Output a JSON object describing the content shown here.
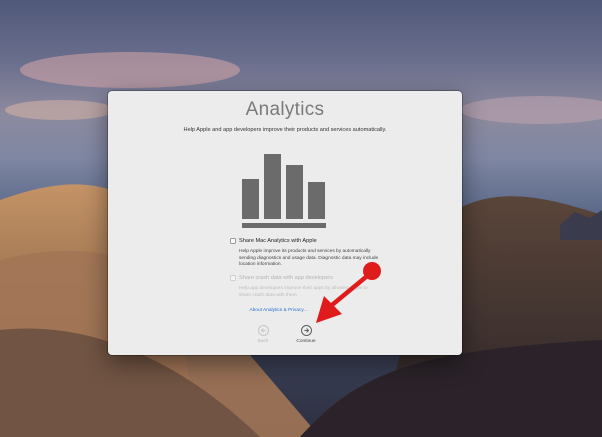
{
  "dialog": {
    "title": "Analytics",
    "subtitle": "Help Apple and app developers improve their products and services automatically.",
    "share_mac": {
      "label": "Share Mac Analytics with Apple",
      "checked": false,
      "description": "Help Apple improve its products and services by automatically sending diagnostics and usage data. Diagnostic data may include location information."
    },
    "share_crash": {
      "label": "Share crash data with app developers",
      "checked": false,
      "enabled": false,
      "description": "Help app developers improve their apps by allowing Apple to share crash data with them."
    },
    "about_link": "About Analytics & Privacy…",
    "back_label": "Back",
    "continue_label": "Continue"
  },
  "colors": {
    "dialog_bg": "#ececec",
    "chart_bars": "#6b6b6b",
    "link": "#2a6fd1",
    "annotation_arrow": "#e01b1b"
  },
  "icons": {
    "analytics": "bar-chart-icon",
    "back": "arrow-left-circle-icon",
    "continue": "arrow-right-circle-icon",
    "annotation": "red-arrow-pointer"
  }
}
